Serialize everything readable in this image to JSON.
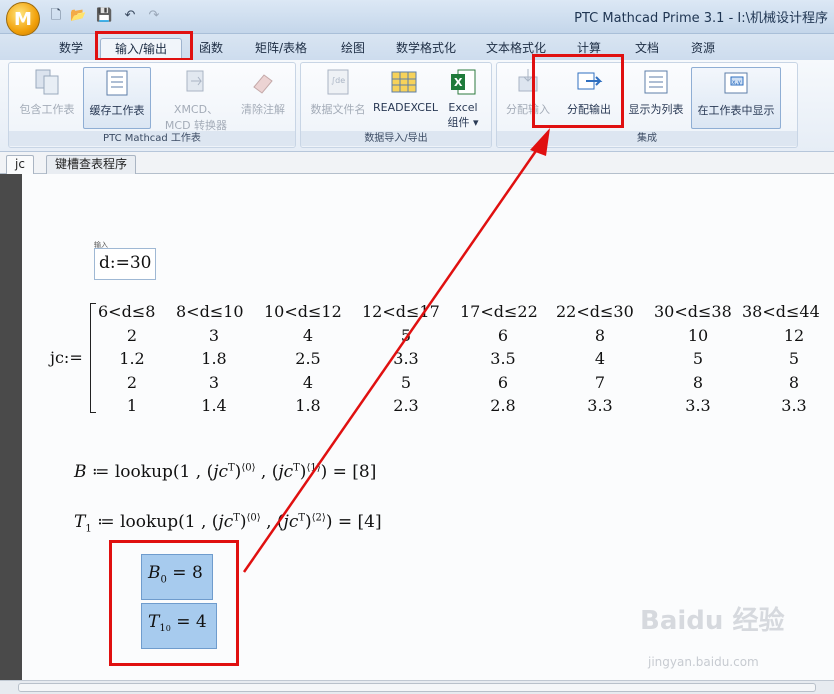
{
  "window": {
    "title": "PTC Mathcad Prime 3.1 - I:\\机械设计程序",
    "orb_letter": "M",
    "doc_title_faded": "键槽查表程序"
  },
  "ribbon_tabs": [
    {
      "label": "数学"
    },
    {
      "label": "输入/输出"
    },
    {
      "label": "函数"
    },
    {
      "label": "矩阵/表格"
    },
    {
      "label": "绘图"
    },
    {
      "label": "数学格式化"
    },
    {
      "label": "文本格式化"
    },
    {
      "label": "计算"
    },
    {
      "label": "文档"
    },
    {
      "label": "资源"
    }
  ],
  "ribbon": {
    "groups": [
      {
        "label": "PTC Mathcad 工作表"
      },
      {
        "label": "数据导入/导出"
      },
      {
        "label": "集成"
      }
    ],
    "buttons": {
      "include_worksheet": "包含工作表",
      "cache_worksheet": "缓存工作表",
      "xmcd_converter_1": "XMCD、",
      "xmcd_converter_2": "MCD 转换器",
      "clear_annotations": "清除注解",
      "data_filename": "数据文件名",
      "readexcel": "READEXCEL",
      "excel_component_1": "Excel",
      "excel_component_2": "组件",
      "assign_input": "分配输入",
      "assign_output": "分配输出",
      "show_as_list": "显示为列表",
      "show_in_worksheet": "在工作表中显示"
    }
  },
  "doc_tabs": [
    {
      "label": "jc"
    },
    {
      "label": "键槽查表程序"
    }
  ],
  "worksheet": {
    "input_tag": "输入",
    "input_expr": "d:=30",
    "matrix_name": "jc:=",
    "matrix_headers": [
      "6<d≤8",
      "8<d≤10",
      "10<d≤12",
      "12<d≤17",
      "17<d≤22",
      "22<d≤30",
      "30<d≤38",
      "38<d≤44"
    ],
    "matrix_rows": [
      [
        "2",
        "3",
        "4",
        "5",
        "6",
        "8",
        "10",
        "12"
      ],
      [
        "1.2",
        "1.8",
        "2.5",
        "3.3",
        "3.5",
        "4",
        "5",
        "5"
      ],
      [
        "2",
        "3",
        "4",
        "5",
        "6",
        "7",
        "8",
        "8"
      ],
      [
        "1",
        "1.4",
        "1.8",
        "2.3",
        "2.8",
        "3.3",
        "3.3",
        "3.3"
      ]
    ],
    "eq_B": {
      "lhs": "B",
      "col1": "⟨0⟩",
      "col2": "⟨1⟩",
      "result": "[8]"
    },
    "eq_T": {
      "lhs": "T",
      "lhs_sub": "1",
      "col1": "⟨0⟩",
      "col2": "⟨2⟩",
      "result": "[4]"
    },
    "eval_B": {
      "name": "B",
      "sub": "0",
      "value": "8"
    },
    "eval_T": {
      "name": "T",
      "sub": "1",
      "sub2": "0",
      "value": "4"
    }
  },
  "watermark": {
    "brand": "Baidu 经验",
    "url": "jingyan.baidu.com"
  },
  "colors": {
    "highlight": "#e01010",
    "eval_fill": "#a7cbee"
  }
}
